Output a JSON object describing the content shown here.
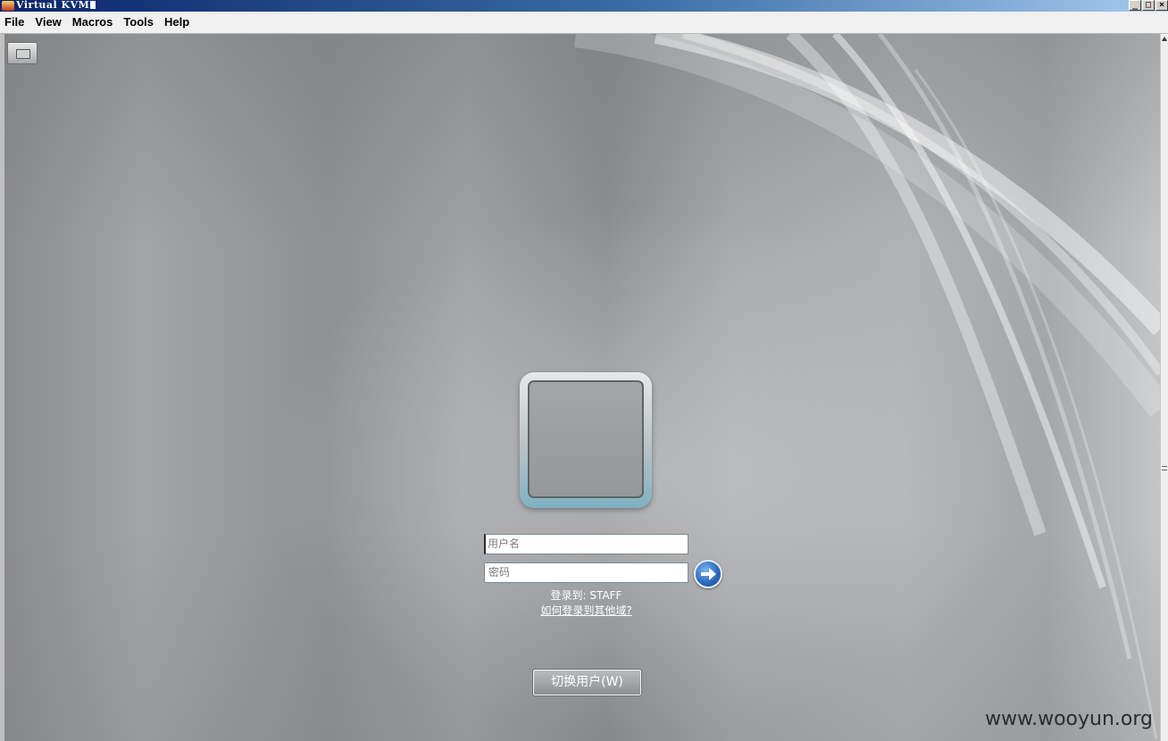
{
  "window": {
    "title": "Virtual KVM",
    "min_label": "_",
    "max_label": "□",
    "close_label": "×"
  },
  "menubar": {
    "items": [
      "File",
      "View",
      "Macros",
      "Tools",
      "Help"
    ]
  },
  "login": {
    "username_placeholder": "用户名",
    "password_placeholder": "密码",
    "domain_text": "登录到: STAFF",
    "other_domain_link": "如何登录到其他域?",
    "switch_user_label": "切换用户(W)",
    "submit_icon": "arrow-right-icon"
  },
  "toolbar": {
    "keyboard_icon": "keyboard-icon"
  },
  "watermark": "www.wooyun.org",
  "colors": {
    "title_bar": "#0a246a",
    "submit_arrow": "#2d6bbd",
    "avatar_frame_accent": "#7fb1c3"
  }
}
